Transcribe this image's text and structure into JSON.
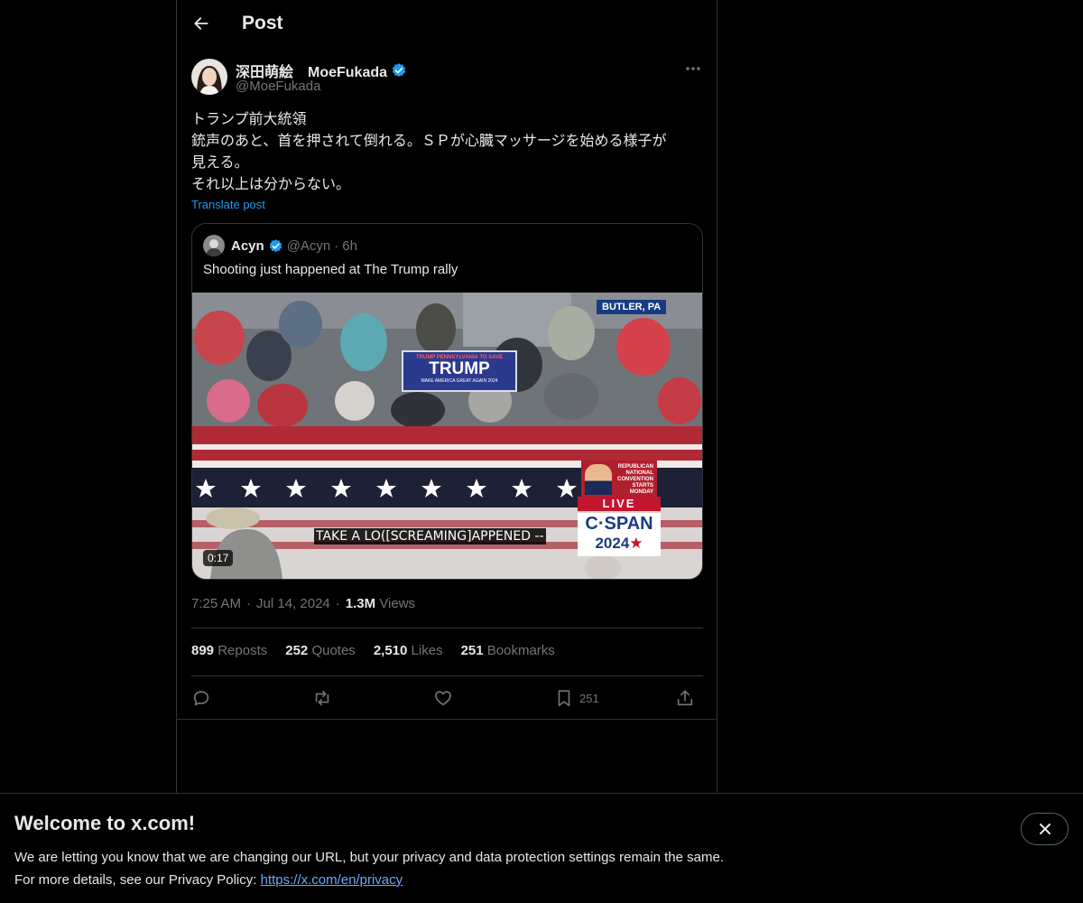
{
  "header": {
    "title": "Post",
    "back_icon": "arrow-left-icon"
  },
  "author": {
    "name": "深田萌絵　MoeFukada",
    "handle": "@MoeFukada",
    "verified": true,
    "verified_color": "#1d9bf0"
  },
  "post": {
    "lines": [
      "トランプ前大統領",
      "銃声のあと、首を押されて倒れる。ＳＰが心臓マッサージを始める様子が",
      "見える。",
      "それ以上は分からない。"
    ],
    "translate_label": "Translate post"
  },
  "quote": {
    "name": "Acyn",
    "handle": "@Acyn",
    "dot": "·",
    "time": "6h",
    "text": "Shooting just happened at The Trump rally",
    "media": {
      "caption": "TAKE A LO([SCREAMING]APPENED --",
      "duration": "0:17",
      "location_badge": "BUTLER, PA",
      "sign_top": "TRUMP PENNSYLVANIA TO SAVE",
      "sign_main": "TRUMP",
      "sign_bottom": "MAKE AMERICA GREAT AGAIN 2024",
      "rnc_text": "REPUBLICAN NATIONAL CONVENTION STARTS MONDAY",
      "live_label": "LIVE",
      "network": "C·SPAN",
      "year_prefix": "2024",
      "year_mark": "★"
    }
  },
  "meta": {
    "time": "7:25 AM",
    "sep1": "·",
    "date": "Jul 14, 2024",
    "sep2": "·",
    "views_count": "1.3M",
    "views_label": "Views"
  },
  "stats": {
    "reposts_count": "899",
    "reposts_label": "Reposts",
    "quotes_count": "252",
    "quotes_label": "Quotes",
    "likes_count": "2,510",
    "likes_label": "Likes",
    "bookmarks_count": "251",
    "bookmarks_label": "Bookmarks"
  },
  "actions": {
    "reply_icon": "reply-icon",
    "repost_icon": "repost-icon",
    "like_icon": "heart-icon",
    "bookmark_icon": "bookmark-icon",
    "bookmark_count": "251",
    "share_icon": "share-icon"
  },
  "banner": {
    "title": "Welcome to x.com!",
    "line1": "We are letting you know that we are changing our URL, but your privacy and data protection settings remain the same.",
    "line2_prefix": "For more details, see our Privacy Policy: ",
    "link": "https://x.com/en/privacy",
    "close_icon": "close-icon"
  }
}
